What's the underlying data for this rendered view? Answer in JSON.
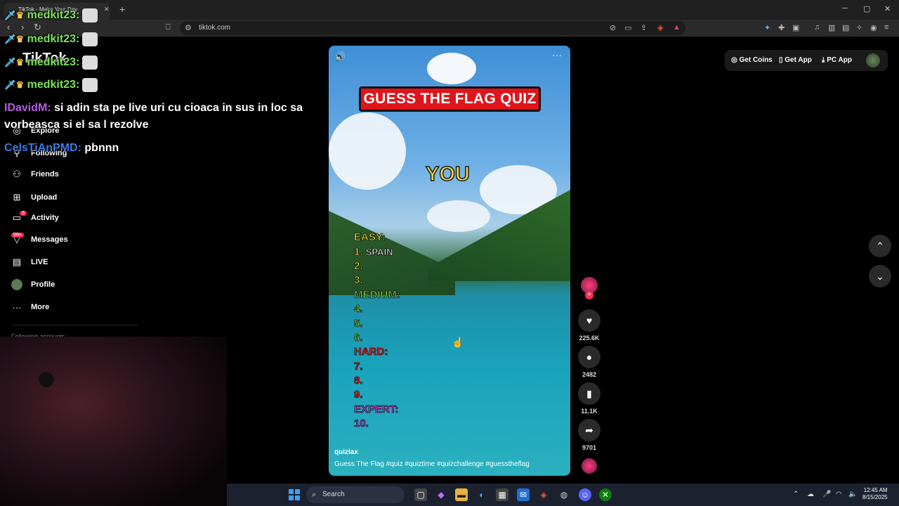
{
  "browser": {
    "tab_title": "TikTok - Make Your Day",
    "url": "tiktok.com"
  },
  "tiktok": {
    "logo": "TikTok",
    "nav": [
      {
        "label": "Explore",
        "icon": "compass-icon"
      },
      {
        "label": "Following",
        "icon": "following-icon"
      },
      {
        "label": "Friends",
        "icon": "friends-icon"
      },
      {
        "label": "Upload",
        "icon": "upload-icon"
      },
      {
        "label": "Activity",
        "icon": "activity-icon",
        "badge": "3"
      },
      {
        "label": "Messages",
        "icon": "messages-icon",
        "badge": "99+"
      },
      {
        "label": "LIVE",
        "icon": "live-icon"
      },
      {
        "label": "Profile",
        "icon": "profile-avatar"
      },
      {
        "label": "More",
        "icon": "more-icon"
      }
    ],
    "following_accounts": "Following accounts",
    "top_buttons": {
      "coins": "Get Coins",
      "app": "Get App",
      "pc_app": "PC App"
    }
  },
  "chat": [
    {
      "user": "medkit23:",
      "message": ""
    },
    {
      "user": "medkit23:",
      "message": ""
    },
    {
      "user": "medkit23:",
      "message": ""
    },
    {
      "user": "medkit23:",
      "message": ""
    },
    {
      "user": "IDavidM:",
      "message": "si adin sta pe live uri cu cioaca in sus in loc sa"
    },
    {
      "user": "",
      "message": "vorbeasca si el sa l rezolve"
    },
    {
      "user": "CelsTiAnPMD:",
      "message": "pbnnn"
    }
  ],
  "video": {
    "title": "GUESS THE FLAG QUIZ",
    "you": "YOU",
    "quiz_lines": [
      {
        "text": "EASY:",
        "cls": "c-yel"
      },
      {
        "text": "1.",
        "cls": "c-yel",
        "answer": "SPAIN"
      },
      {
        "text": "2.",
        "cls": "c-yel"
      },
      {
        "text": "3.",
        "cls": "c-yel"
      },
      {
        "text": "MEDIUM:",
        "cls": "c-grn"
      },
      {
        "text": "4.",
        "cls": "c-grn"
      },
      {
        "text": "5.",
        "cls": "c-grn"
      },
      {
        "text": "6.",
        "cls": "c-grn"
      },
      {
        "text": "HARD:",
        "cls": "c-red"
      },
      {
        "text": "7.",
        "cls": "c-red"
      },
      {
        "text": "8.",
        "cls": "c-red"
      },
      {
        "text": "9.",
        "cls": "c-red"
      },
      {
        "text": "EXPERT:",
        "cls": "c-pur"
      },
      {
        "text": "10.",
        "cls": "c-pur"
      }
    ],
    "author": "quizlax",
    "caption": "Guess The Flag #quiz  #quiztime  #quizchallenge  #guesstheflag",
    "likes": "225.6K",
    "comments": "2482",
    "saves": "11.1K",
    "shares": "9701"
  },
  "taskbar": {
    "search": "Search",
    "time": "12:45 AM",
    "date": "8/15/2025"
  }
}
